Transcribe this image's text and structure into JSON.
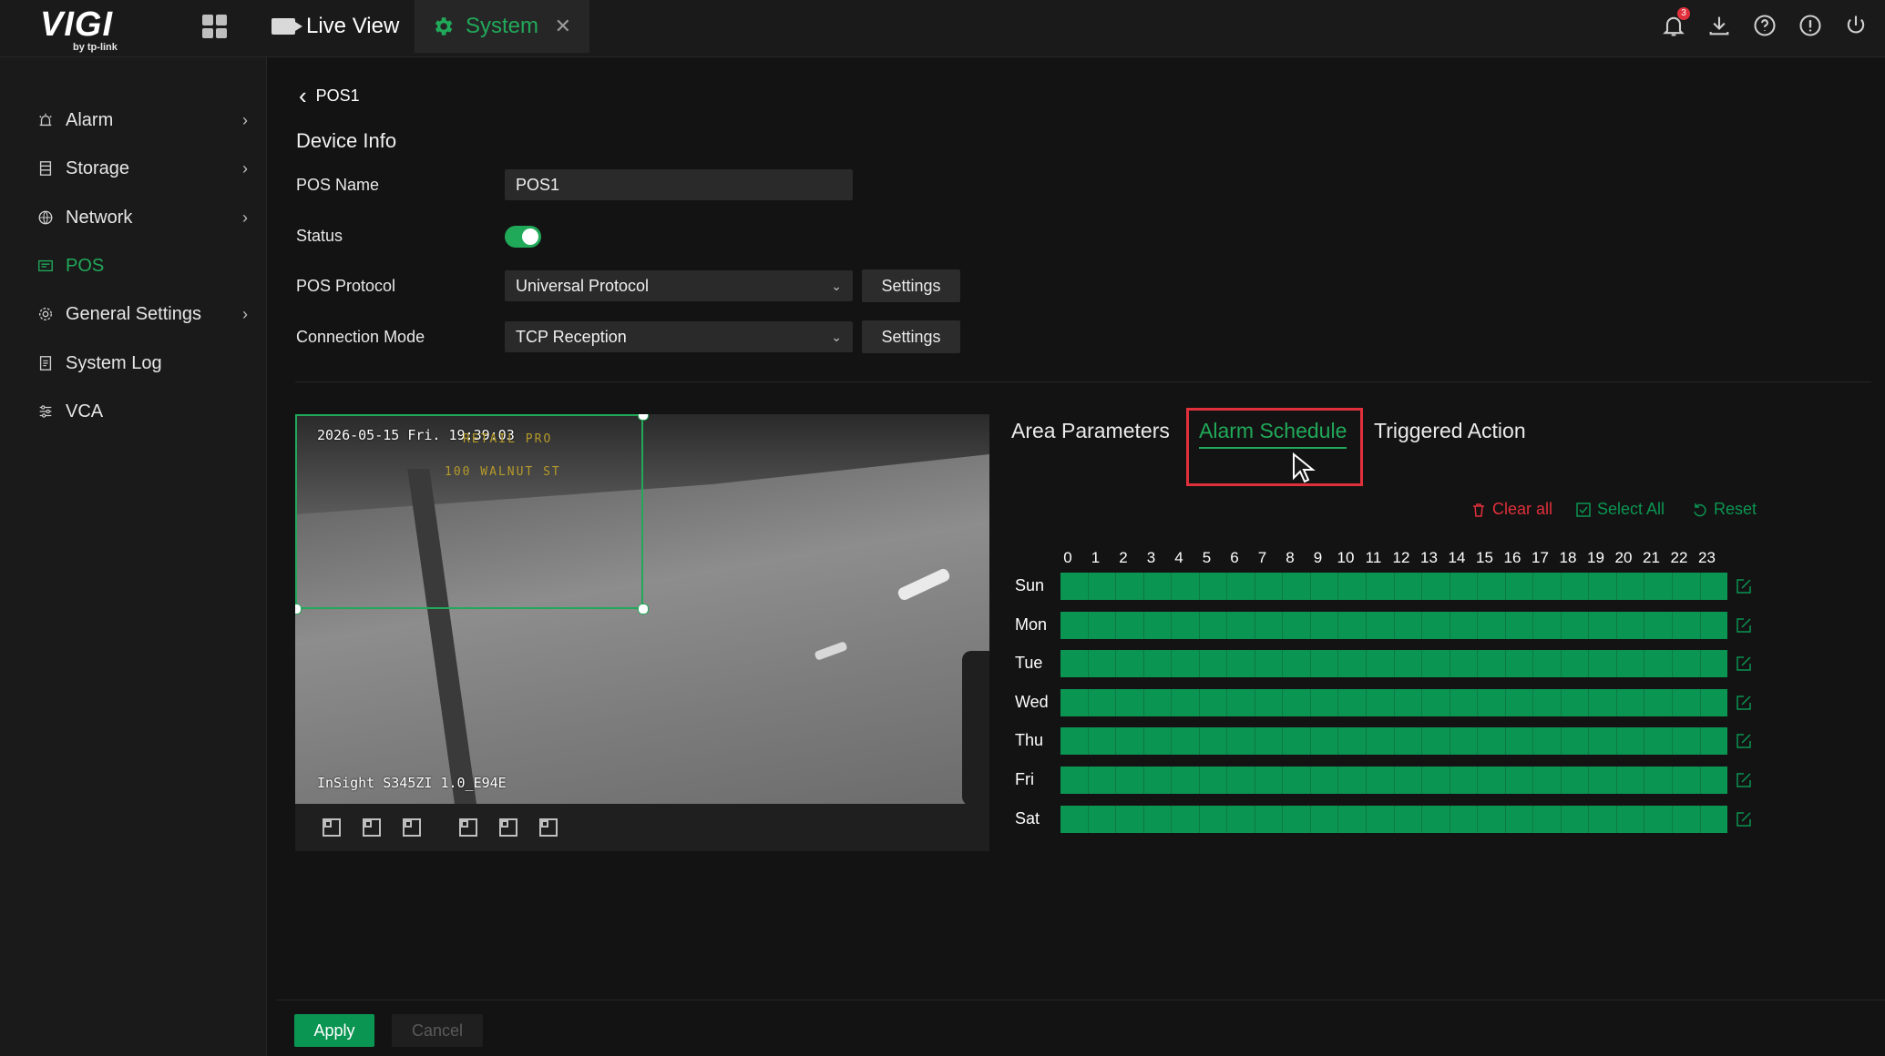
{
  "header": {
    "brand": "VIGI",
    "brand_sub": "by tp-link",
    "apps_icon": "apps-grid-icon",
    "tabs": [
      {
        "label": "Live View",
        "icon": "camera-icon"
      },
      {
        "label": "System",
        "icon": "gear-icon",
        "active": true
      }
    ],
    "notification_count": "3",
    "right_icons": [
      "bell-icon",
      "download-icon",
      "help-icon",
      "info-icon",
      "power-icon"
    ]
  },
  "sidebar": {
    "items": [
      {
        "label": "Alarm",
        "icon": "alarm-icon",
        "has_children": true
      },
      {
        "label": "Storage",
        "icon": "storage-icon",
        "has_children": true
      },
      {
        "label": "Network",
        "icon": "globe-icon",
        "has_children": true
      },
      {
        "label": "POS",
        "icon": "pos-icon",
        "active": true
      },
      {
        "label": "General Settings",
        "icon": "settings-icon",
        "has_children": true
      },
      {
        "label": "System Log",
        "icon": "log-icon"
      },
      {
        "label": "VCA",
        "icon": "vca-icon"
      }
    ]
  },
  "breadcrumb": {
    "label": "POS1"
  },
  "device_info": {
    "title": "Device Info",
    "pos_name_label": "POS Name",
    "pos_name_value": "POS1",
    "status_label": "Status",
    "status_on": true,
    "protocol_label": "POS Protocol",
    "protocol_value": "Universal Protocol",
    "connection_label": "Connection Mode",
    "connection_value": "TCP Reception",
    "settings_label": "Settings"
  },
  "video": {
    "timestamp": "2026-05-15 Fri. 19:39:03",
    "overlay_line1": "RETAIL PRO",
    "overlay_line2": "100 WALNUT ST",
    "camera_name": "InSight S345ZI 1.0_E94E"
  },
  "tabs": {
    "area_parameters": "Area Parameters",
    "alarm_schedule": "Alarm Schedule",
    "triggered_action": "Triggered Action"
  },
  "schedule_actions": {
    "clear_all": "Clear all",
    "select_all": "Select All",
    "reset": "Reset",
    "clear_color": "#e0303b",
    "normal_color": "#0b9552"
  },
  "schedule": {
    "hours": [
      "0",
      "1",
      "2",
      "3",
      "4",
      "5",
      "6",
      "7",
      "8",
      "9",
      "10",
      "11",
      "12",
      "13",
      "14",
      "15",
      "16",
      "17",
      "18",
      "19",
      "20",
      "21",
      "22",
      "23"
    ],
    "days": [
      "Sun",
      "Mon",
      "Tue",
      "Wed",
      "Thu",
      "Fri",
      "Sat"
    ],
    "fill_color": "#0b9552"
  },
  "footer": {
    "apply": "Apply",
    "cancel": "Cancel"
  }
}
